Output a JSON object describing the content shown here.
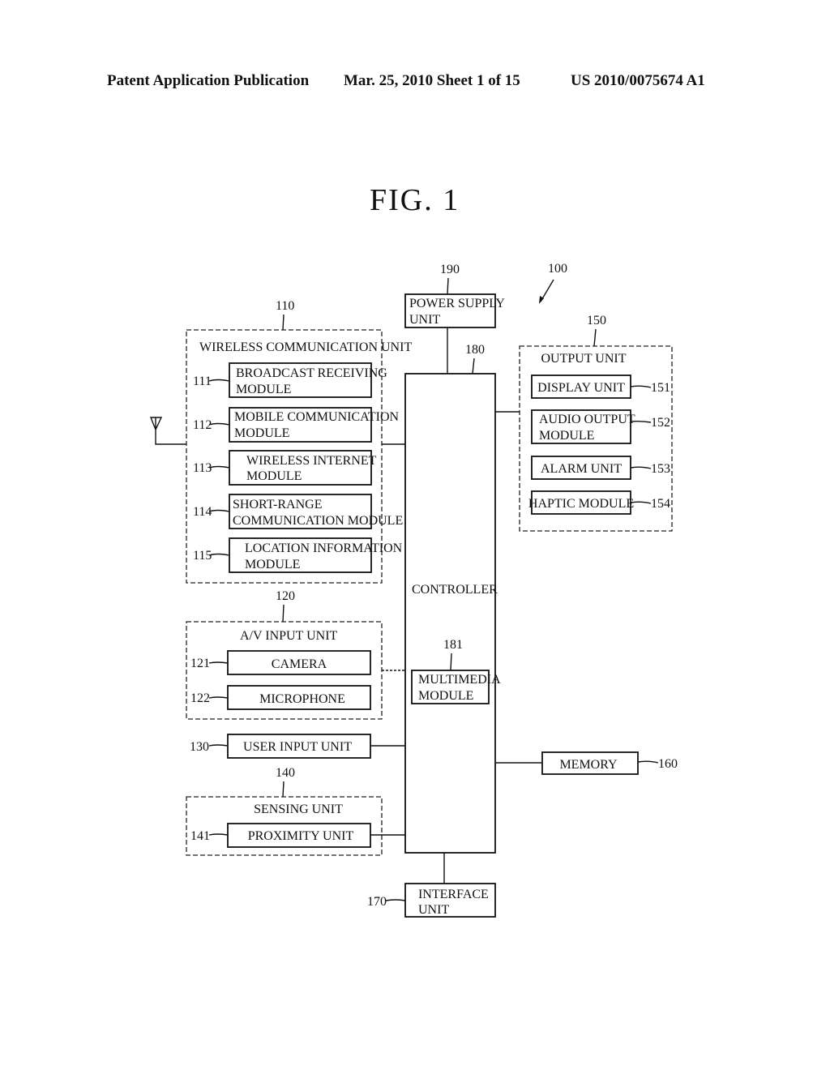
{
  "header": {
    "left": "Patent Application Publication",
    "middle": "Mar. 25, 2010  Sheet 1 of 15",
    "right": "US 2010/0075674 A1"
  },
  "figure_title": "FIG.  1",
  "device_ref": "100",
  "wireless": {
    "ref": "110",
    "title": "WIRELESS COMMUNICATION UNIT",
    "modules": [
      {
        "ref": "111",
        "line1": "BROADCAST RECEIVING",
        "line2": "MODULE"
      },
      {
        "ref": "112",
        "line1": "MOBILE COMMUNICATION",
        "line2": "MODULE"
      },
      {
        "ref": "113",
        "line1": "WIRELESS INTERNET",
        "line2": "MODULE"
      },
      {
        "ref": "114",
        "line1": "SHORT-RANGE",
        "line2": "COMMUNICATION MODULE"
      },
      {
        "ref": "115",
        "line1": "LOCATION INFORMATION",
        "line2": "MODULE"
      }
    ]
  },
  "av_input": {
    "ref": "120",
    "title": "A/V INPUT UNIT",
    "modules": [
      {
        "ref": "121",
        "label": "CAMERA"
      },
      {
        "ref": "122",
        "label": "MICROPHONE"
      }
    ]
  },
  "user_input": {
    "ref": "130",
    "label": "USER INPUT UNIT"
  },
  "sensing": {
    "ref": "140",
    "title": "SENSING UNIT",
    "modules": [
      {
        "ref": "141",
        "label": "PROXIMITY UNIT"
      }
    ]
  },
  "output": {
    "ref": "150",
    "title": "OUTPUT UNIT",
    "modules": [
      {
        "ref": "151",
        "line1": "DISPLAY UNIT",
        "line2": ""
      },
      {
        "ref": "152",
        "line1": "AUDIO OUTPUT",
        "line2": "MODULE"
      },
      {
        "ref": "153",
        "line1": "ALARM UNIT",
        "line2": ""
      },
      {
        "ref": "154",
        "line1": "HAPTIC MODULE",
        "line2": ""
      }
    ]
  },
  "memory": {
    "ref": "160",
    "label": "MEMORY"
  },
  "interface": {
    "ref": "170",
    "line1": "INTERFACE",
    "line2": "UNIT"
  },
  "controller": {
    "ref": "180",
    "label": "CONTROLLER",
    "multimedia": {
      "ref": "181",
      "line1": "MULTIMEDIA",
      "line2": "MODULE"
    }
  },
  "power": {
    "ref": "190",
    "line1": "POWER SUPPLY",
    "line2": "UNIT"
  }
}
